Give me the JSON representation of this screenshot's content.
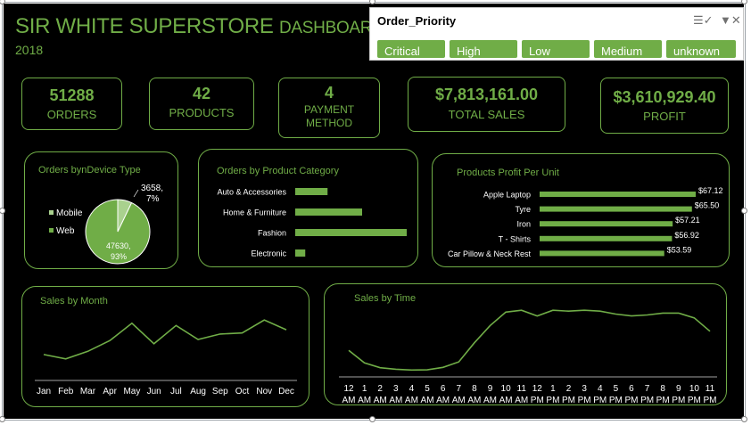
{
  "header": {
    "title_main": "SIR WHITE SUPERSTORE",
    "title_suffix": "DASHBOARD",
    "year": "2018"
  },
  "kpis": [
    {
      "value": "51288",
      "label": "ORDERS"
    },
    {
      "value": "42",
      "label": "PRODUCTS"
    },
    {
      "value": "4",
      "label_line1": "PAYMENT",
      "label_line2": "METHOD"
    },
    {
      "value": "$7,813,161.00",
      "label": "TOTAL SALES"
    },
    {
      "value": "$3,610,929.40",
      "label": "PROFIT"
    }
  ],
  "slicer": {
    "title": "Order_Priority",
    "items": [
      "Critical",
      "High",
      "Low",
      "Medium",
      "unknown"
    ],
    "icons": [
      "multi-select-icon",
      "clear-filter-icon"
    ]
  },
  "colors": {
    "background": "#000000",
    "accent": "#70ad47",
    "accent_light": "#a9d18e"
  },
  "chart_data": [
    {
      "type": "pie",
      "title": "Orders bynDevice Type",
      "categories": [
        "Mobile",
        "Web"
      ],
      "values": [
        3658,
        47630
      ],
      "labels": [
        {
          "line1": "3658,",
          "line2": "7%"
        },
        {
          "line1": "47630,",
          "line2": "93%"
        }
      ],
      "legend": "left"
    },
    {
      "type": "bar",
      "orientation": "horizontal",
      "title": "Orders by Product Category",
      "categories": [
        "Auto & Accessories",
        "Home & Furniture",
        "Fashion",
        "Electronic"
      ],
      "values": [
        2900,
        6000,
        10000,
        900
      ]
    },
    {
      "type": "bar",
      "orientation": "horizontal",
      "title": "Products Profit Per Unit",
      "categories": [
        "Apple Laptop",
        "Tyre",
        "Iron",
        "T - Shirts",
        "Car Pillow & Neck Rest"
      ],
      "values": [
        67.12,
        65.5,
        57.21,
        56.92,
        53.59
      ],
      "data_labels": [
        "$67.12",
        "$65.50",
        "$57.21",
        "$56.92",
        "$53.59"
      ]
    },
    {
      "type": "line",
      "title": "Sales by Month",
      "categories": [
        "Jan",
        "Feb",
        "Mar",
        "Apr",
        "May",
        "Jun",
        "Jul",
        "Aug",
        "Sep",
        "Oct",
        "Nov",
        "Dec"
      ],
      "values": [
        600000,
        560000,
        630000,
        730000,
        890000,
        700000,
        870000,
        740000,
        790000,
        800000,
        920000,
        830000
      ]
    },
    {
      "type": "line",
      "title": "Sales by Time",
      "categories": [
        {
          "h": "12",
          "p": "AM"
        },
        {
          "h": "1",
          "p": "AM"
        },
        {
          "h": "2",
          "p": "AM"
        },
        {
          "h": "3",
          "p": "AM"
        },
        {
          "h": "4",
          "p": "AM"
        },
        {
          "h": "5",
          "p": "AM"
        },
        {
          "h": "6",
          "p": "AM"
        },
        {
          "h": "7",
          "p": "AM"
        },
        {
          "h": "8",
          "p": "AM"
        },
        {
          "h": "9",
          "p": "AM"
        },
        {
          "h": "10",
          "p": "AM"
        },
        {
          "h": "11",
          "p": "AM"
        },
        {
          "h": "12",
          "p": "PM"
        },
        {
          "h": "1",
          "p": "PM"
        },
        {
          "h": "2",
          "p": "PM"
        },
        {
          "h": "3",
          "p": "PM"
        },
        {
          "h": "4",
          "p": "PM"
        },
        {
          "h": "5",
          "p": "PM"
        },
        {
          "h": "6",
          "p": "PM"
        },
        {
          "h": "7",
          "p": "PM"
        },
        {
          "h": "8",
          "p": "PM"
        },
        {
          "h": "9",
          "p": "PM"
        },
        {
          "h": "10",
          "p": "PM"
        },
        {
          "h": "11",
          "p": "PM"
        }
      ],
      "values": [
        110000,
        45000,
        20000,
        12000,
        8000,
        9000,
        22000,
        50000,
        150000,
        240000,
        310000,
        320000,
        290000,
        320000,
        315000,
        320000,
        315000,
        300000,
        290000,
        295000,
        305000,
        305000,
        280000,
        210000
      ]
    }
  ]
}
